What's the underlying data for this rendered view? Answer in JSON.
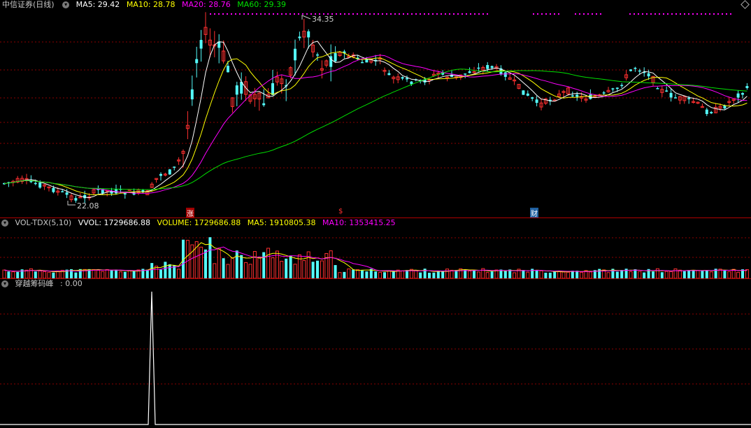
{
  "price_panel": {
    "title": "中信证券(日线)",
    "ma5": "MA5: 29.42",
    "ma10": "MA10: 28.78",
    "ma20": "MA20: 28.76",
    "ma60": "MA60: 29.39",
    "high_label": "34.35",
    "low_label": "22.08",
    "markers": [
      "涨",
      "$",
      "财"
    ]
  },
  "volume_panel": {
    "name": "VOL-TDX(5,10)",
    "vvol": "VVOL: 1729686.88",
    "volume": "VOLUME: 1729686.88",
    "ma5": "MA5: 1910805.38",
    "ma10": "MA10: 1353415.25"
  },
  "indicator_panel": {
    "name": "穿越筹码峰",
    "value": ": 0.00"
  },
  "colors": {
    "up": "#ff3030",
    "down": "#54fcfc",
    "ma5": "#ffffff",
    "ma10": "#ffff00",
    "ma20": "#ff00ff",
    "ma60": "#00e000",
    "grid": "#8b0000"
  }
}
